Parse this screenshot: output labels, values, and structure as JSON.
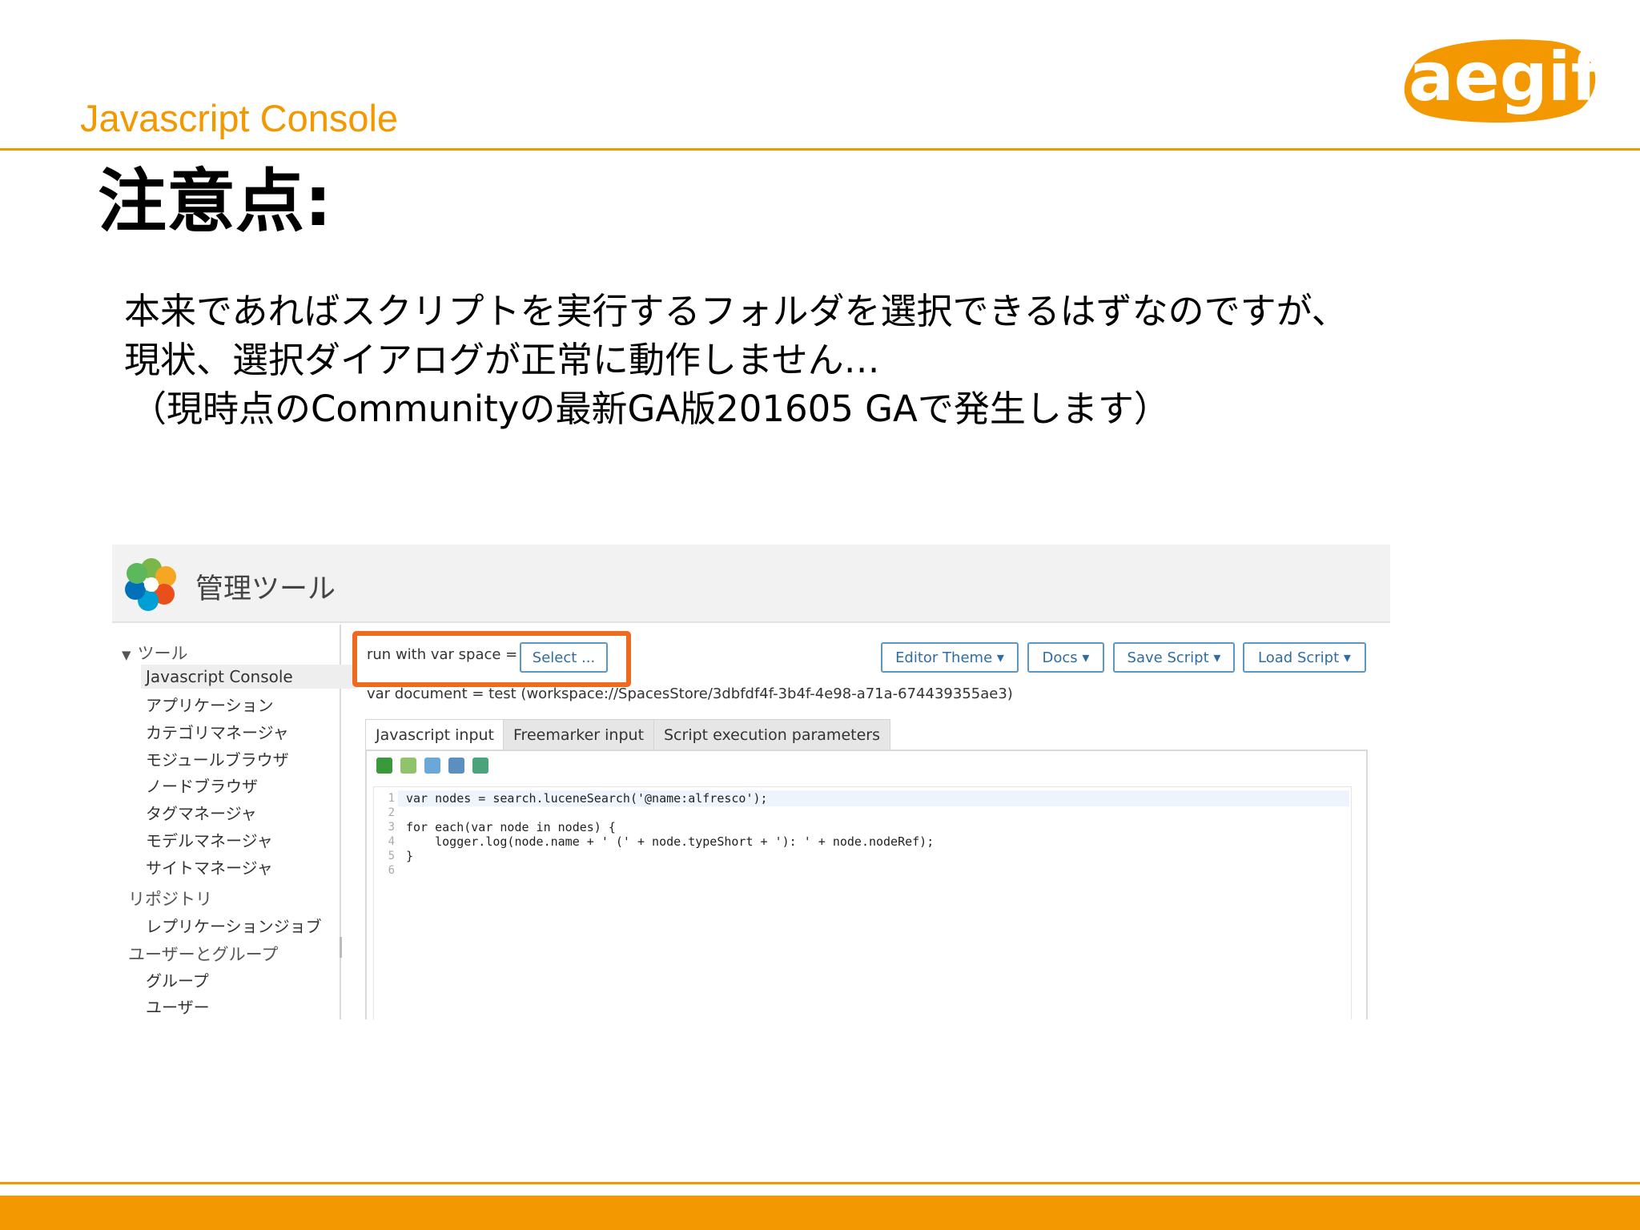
{
  "slide": {
    "section_label": "Javascript Console",
    "logo_text": "aegif",
    "title": "注意点:",
    "body_lines": [
      "本来であればスクリプトを実行するフォルダを選択できるはずなのですが、",
      "現状、選択ダイアログが正常に動作しません…",
      "（現時点のCommunityの最新GA版201605 GAで発生します）"
    ],
    "colors": {
      "accent": "#f39800",
      "highlight_box": "#ee6a1f"
    }
  },
  "screenshot": {
    "app_title": "管理ツール",
    "sidebar": {
      "groups": [
        {
          "label": "ツール",
          "items": [
            "Javascript Console",
            "アプリケーション",
            "カテゴリマネージャ",
            "モジュールブラウザ",
            "ノードブラウザ",
            "タグマネージャ",
            "モデルマネージャ",
            "サイトマネージャ"
          ]
        },
        {
          "label": "リポジトリ",
          "items": [
            "レプリケーションジョブ"
          ]
        },
        {
          "label": "ユーザーとグループ",
          "items": [
            "グループ",
            "ユーザー"
          ]
        }
      ],
      "active_item": "Javascript Console"
    },
    "run_label": "run with var space =",
    "select_button": "Select ...",
    "toolbar_buttons": [
      "Editor Theme",
      "Docs",
      "Save Script",
      "Load Script"
    ],
    "dropdown_caret": "▾",
    "document_line": "var document = test (workspace://SpacesStore/3dbfdf4f-3b4f-4e98-a71a-674439355ae3)",
    "tabs": [
      "Javascript input",
      "Freemarker input",
      "Script execution parameters"
    ],
    "active_tab": "Javascript input",
    "editor_tool_icons": [
      "undo-icon",
      "redo-icon",
      "format-icon",
      "indent-icon",
      "save-file-icon"
    ],
    "code": {
      "line_numbers": [
        "1",
        "2",
        "3",
        "4",
        "5",
        "6"
      ],
      "lines": [
        "var nodes = search.luceneSearch('@name:alfresco');",
        "",
        "for each(var node in nodes) {",
        "    logger.log(node.name + ' (' + node.typeShort + '): ' + node.nodeRef);",
        "}",
        ""
      ]
    }
  }
}
